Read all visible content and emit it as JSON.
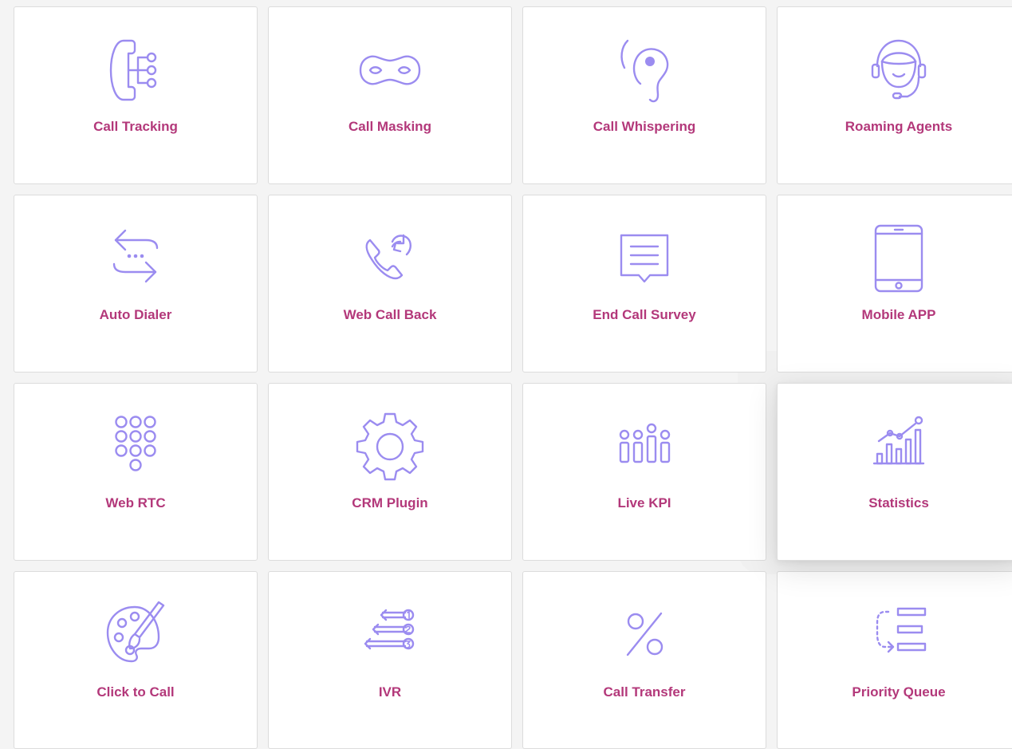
{
  "features": [
    {
      "label": "Call Tracking",
      "icon": "call-tracking-icon"
    },
    {
      "label": "Call Masking",
      "icon": "mask-icon"
    },
    {
      "label": "Call Whispering",
      "icon": "ear-icon"
    },
    {
      "label": "Roaming Agents",
      "icon": "headset-agent-icon"
    },
    {
      "label": "Auto Dialer",
      "icon": "swap-arrows-icon"
    },
    {
      "label": "Web Call Back",
      "icon": "phone-callback-icon"
    },
    {
      "label": "End Call Survey",
      "icon": "message-lines-icon"
    },
    {
      "label": "Mobile APP",
      "icon": "mobile-phone-icon"
    },
    {
      "label": "Web RTC",
      "icon": "keypad-icon"
    },
    {
      "label": "CRM Plugin",
      "icon": "gear-icon"
    },
    {
      "label": "Live KPI",
      "icon": "kpi-bars-icon"
    },
    {
      "label": "Statistics",
      "icon": "statistics-chart-icon"
    },
    {
      "label": "Click to Call",
      "icon": "palette-brush-icon"
    },
    {
      "label": "IVR",
      "icon": "numbered-arrows-icon"
    },
    {
      "label": "Call Transfer",
      "icon": "percent-icon"
    },
    {
      "label": "Priority Queue",
      "icon": "priority-list-icon"
    }
  ],
  "colors": {
    "icon": "#9b8cf0",
    "label": "#b3387a",
    "card_bg": "#ffffff",
    "page_bg": "#f4f4f4"
  }
}
